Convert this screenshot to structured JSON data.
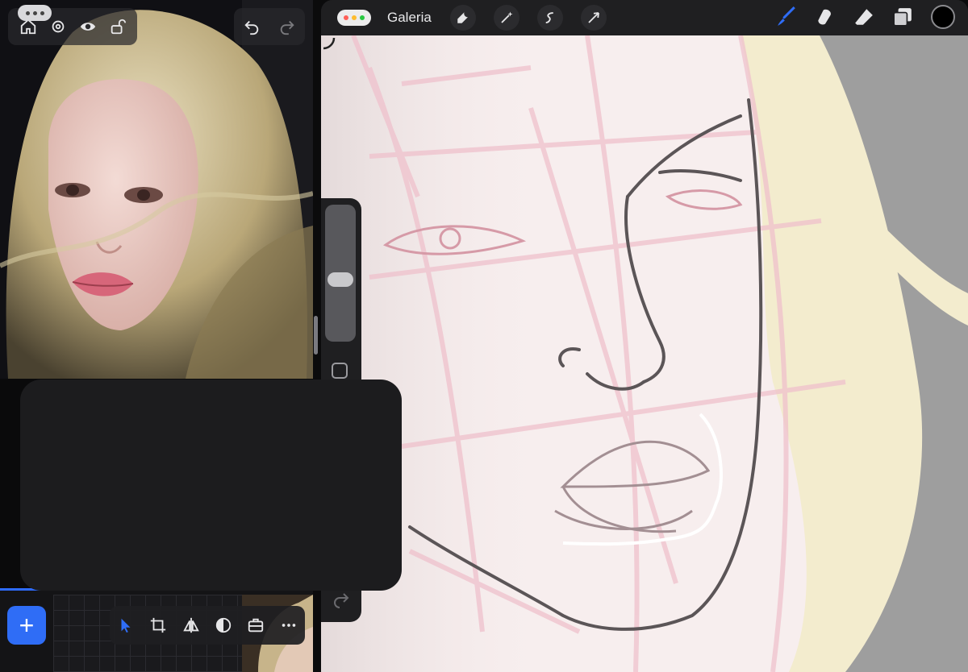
{
  "left_app": {
    "toolbar_top": {
      "icons": [
        "home-icon",
        "gear-icon",
        "eye-icon",
        "unlock-icon"
      ],
      "undo_icon": "undo-icon",
      "redo_icon": "redo-icon"
    },
    "more_pill_icon": "ellipsis-icon",
    "add_button_label": "+",
    "bottom_toolbar": [
      "cursor-icon",
      "crop-icon",
      "flip-icon",
      "adjust-icon",
      "briefcase-icon",
      "ellipsis-icon"
    ],
    "accent_color": "#2f6df6"
  },
  "drawing_app": {
    "gallery_label": "Galeria",
    "traffic_colors": [
      "#ff5f57",
      "#febc2e",
      "#28c840"
    ],
    "advanced_tools": [
      "wrench-icon",
      "magic-wand-icon",
      "selection-icon",
      "transform-arrow-icon"
    ],
    "painting_tools": [
      "brush-icon",
      "smudge-icon",
      "eraser-icon",
      "layers-icon"
    ],
    "active_tool": "brush-icon",
    "active_tool_color": "#2f6df6",
    "current_color": "#000000",
    "brush_size_fraction": 0.52
  }
}
